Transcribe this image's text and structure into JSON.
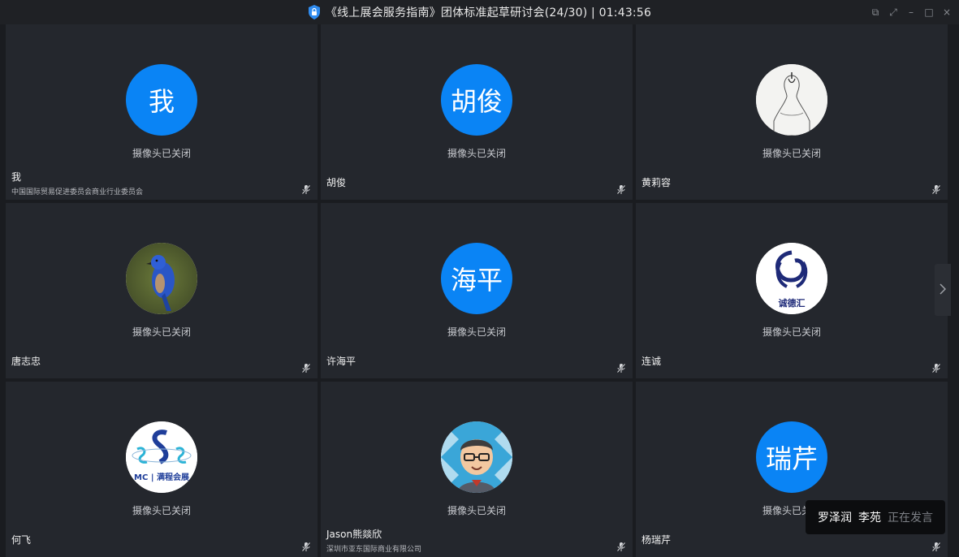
{
  "title": {
    "text": "《线上展会服务指南》团体标准起草研讨会(24/30)  |  01:43:56"
  },
  "window_controls": {
    "popout": "⧉",
    "fullscreen": "⤢",
    "minimize": "–",
    "maximize": "□",
    "close": "×"
  },
  "camera_off_text": "摄像头已关闭",
  "participants": [
    {
      "avatar_text": "我",
      "avatar_type": "text",
      "name": "我",
      "org": "中国国际贸易促进委员会商业行业委员会"
    },
    {
      "avatar_text": "胡俊",
      "avatar_type": "text",
      "name": "胡俊",
      "org": ""
    },
    {
      "avatar_text": "",
      "avatar_type": "sketch-portrait",
      "name": "黄莉容",
      "org": ""
    },
    {
      "avatar_text": "",
      "avatar_type": "blue-bird-photo",
      "name": "唐志忠",
      "org": ""
    },
    {
      "avatar_text": "海平",
      "avatar_type": "text",
      "name": "许海平",
      "org": ""
    },
    {
      "avatar_text": "",
      "avatar_type": "logo-chengdehui",
      "name": "连诚",
      "org": ""
    },
    {
      "avatar_text": "",
      "avatar_type": "logo-sss",
      "name": "何飞",
      "org": ""
    },
    {
      "avatar_text": "",
      "avatar_type": "cartoon-man",
      "name": "Jason熊燚欣",
      "org": "深圳市亚东国际商业有限公司"
    },
    {
      "avatar_text": "瑞芹",
      "avatar_type": "text",
      "name": "杨瑞芹",
      "org": ""
    }
  ],
  "logo_text": {
    "chengdehui": "诚德汇",
    "sss_caption": "MC | 满程会展"
  },
  "speaking": {
    "names": [
      "罗泽润",
      "李苑"
    ],
    "status": "正在发言"
  },
  "colors": {
    "avatar_blue": "#0a84f5",
    "tile_bg": "#24272d",
    "shield_blue": "#2f8cf0"
  }
}
